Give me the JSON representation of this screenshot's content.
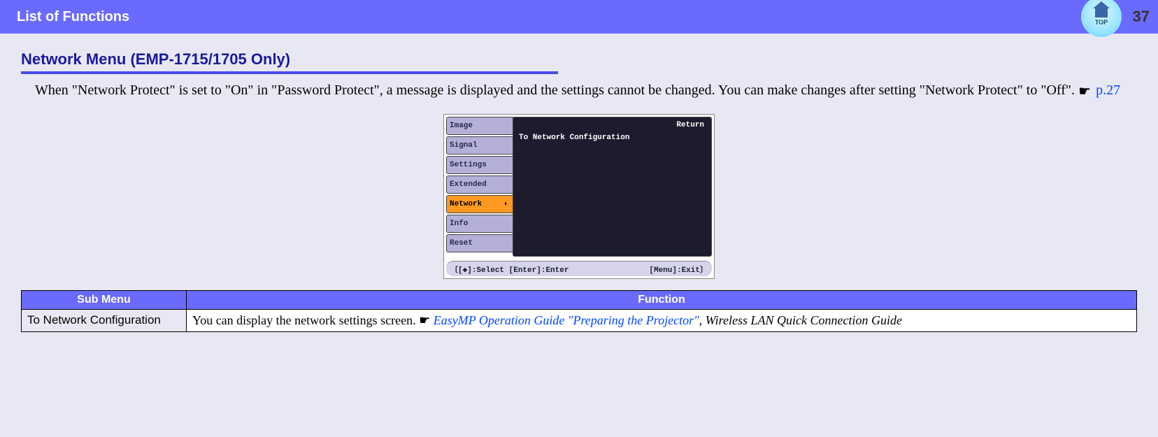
{
  "header": {
    "title": "List of Functions",
    "page_number": "37",
    "top_label": "TOP"
  },
  "section": {
    "title": "Network Menu (EMP-1715/1705 Only)"
  },
  "body": {
    "text_before_link": "When \"Network Protect\" is set to \"On\" in \"Password Protect\", a message is displayed and the settings cannot be changed. You can make changes after setting \"Network Protect\" to \"Off\". ",
    "hand": "☛",
    "page_ref": "p.27"
  },
  "menu": {
    "tabs": [
      "Image",
      "Signal",
      "Settings",
      "Extended",
      "Network",
      "Info",
      "Reset"
    ],
    "selected_index": 4,
    "panel_return": "Return",
    "panel_item": "To Network Configuration",
    "footer_left": "〔[◆]:Select [Enter]:Enter",
    "footer_right": "[Menu]:Exit〕"
  },
  "table": {
    "header_sub": "Sub Menu",
    "header_func": "Function",
    "row": {
      "sub": "To Network Configuration",
      "func_text": "You can display the network settings screen. ",
      "hand": "☛",
      "link": "EasyMP Operation Guide \"Preparing the Projector\"",
      "trailing_prefix": ", ",
      "trailing_italic": "Wireless LAN Quick Connection Guide"
    }
  }
}
